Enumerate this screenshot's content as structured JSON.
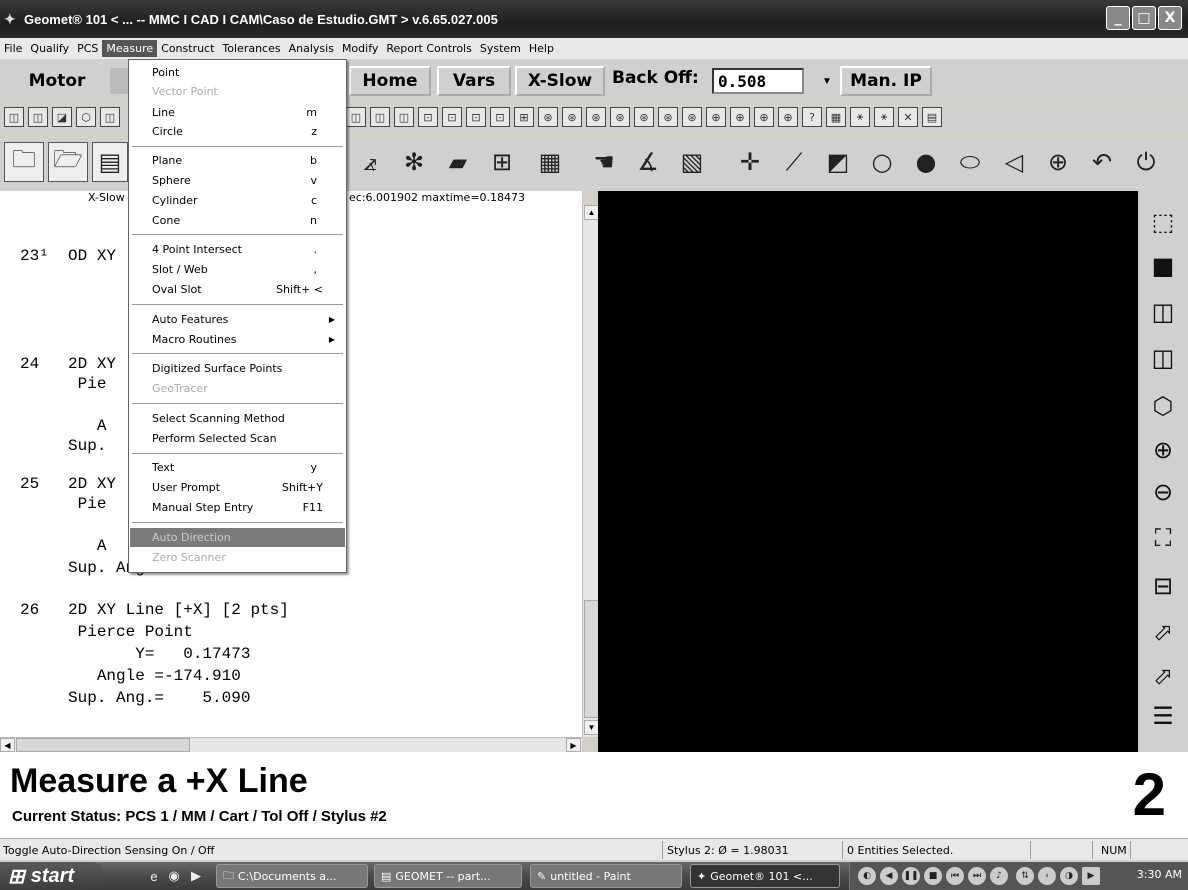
{
  "window": {
    "title": "Geomet® 101 < ... -- MMC I CAD I CAM\\Caso de Estudio.GMT > v.6.65.027.005",
    "minimize": "_",
    "maximize": "□",
    "close": "X"
  },
  "menubar": [
    "File",
    "Qualify",
    "PCS",
    "Measure",
    "Construct",
    "Tolerances",
    "Analysis",
    "Modify",
    "Report Controls",
    "System",
    "Help"
  ],
  "toolbar_big": {
    "motor": "Motor",
    "home": "Home",
    "vars": "Vars",
    "xslow": "X-Slow",
    "backoff_label": "Back Off:",
    "backoff_value": "0.508",
    "manip": "Man. IP"
  },
  "measure_menu": {
    "items": [
      {
        "label": "Point",
        "shortcut": "",
        "state": "normal"
      },
      {
        "label": "Vector Point",
        "shortcut": "",
        "state": "disabled"
      },
      {
        "label": "Line",
        "shortcut": "m",
        "state": "normal"
      },
      {
        "label": "Circle",
        "shortcut": "z",
        "state": "normal"
      },
      {
        "label": "Plane",
        "shortcut": "b",
        "state": "normal"
      },
      {
        "label": "Sphere",
        "shortcut": "v",
        "state": "normal"
      },
      {
        "label": "Cylinder",
        "shortcut": "c",
        "state": "normal"
      },
      {
        "label": "Cone",
        "shortcut": "n",
        "state": "normal"
      },
      {
        "label": "4 Point Intersect",
        "shortcut": ".",
        "state": "normal"
      },
      {
        "label": "Slot / Web",
        "shortcut": ",",
        "state": "normal"
      },
      {
        "label": "Oval Slot",
        "shortcut": "Shift+ <",
        "state": "normal"
      },
      {
        "label": "Auto Features",
        "shortcut": "",
        "state": "submenu"
      },
      {
        "label": "Macro Routines",
        "shortcut": "",
        "state": "submenu"
      },
      {
        "label": "Digitized Surface Points",
        "shortcut": "",
        "state": "normal"
      },
      {
        "label": "GeoTracer",
        "shortcut": "",
        "state": "disabled"
      },
      {
        "label": "Select Scanning Method",
        "shortcut": "",
        "state": "normal"
      },
      {
        "label": "Perform Selected Scan",
        "shortcut": "",
        "state": "normal"
      },
      {
        "label": "Text",
        "shortcut": "y",
        "state": "normal"
      },
      {
        "label": "User Prompt",
        "shortcut": "Shift+Y",
        "state": "normal"
      },
      {
        "label": "Manual Step Entry",
        "shortcut": "F11",
        "state": "normal"
      },
      {
        "label": "Auto Direction",
        "shortcut": "",
        "state": "highlight"
      },
      {
        "label": "Zero Scanner",
        "shortcut": "",
        "state": "disabled"
      }
    ]
  },
  "report": {
    "header_left": "X-Slow",
    "header_right": "ec:6.001902 maxtime=0.18473",
    "lines": [
      "23¹  OD XY",
      "24   2D XY",
      "      Pie",
      "        A",
      "     Sup.",
      "25   2D XY",
      "      Pie",
      "        A",
      "     Sup. Ang.=  92.818",
      "26   2D XY Line [+X] [2 pts]",
      "      Pierce Point",
      "            Y=   0.17473",
      "        Angle =-174.910",
      "     Sup. Ang.=    5.090"
    ]
  },
  "status": {
    "title": "Measure a +X Line",
    "current": "Current Status: PCS 1 / MM / Cart / Tol Off / Stylus #2",
    "count": "2"
  },
  "statusbar": {
    "hint": "Toggle Auto-Direction Sensing On / Off",
    "stylus": "Stylus 2: Ø = 1.98031",
    "entities": "0 Entities Selected.",
    "num": "NUM"
  },
  "taskbar": {
    "start": "start",
    "tasks": [
      "C:\\Documents a...",
      "GEOMET -- part...",
      "untitled - Paint",
      "Geomet® 101 <..."
    ],
    "clock": "3:30 AM"
  }
}
